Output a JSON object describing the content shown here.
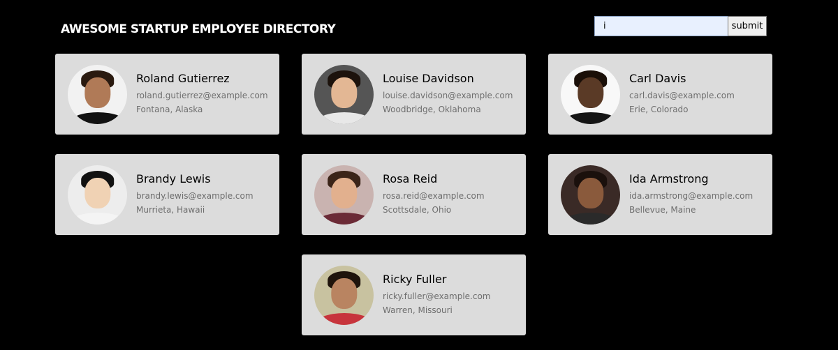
{
  "header": {
    "title": "AWESOME STARTUP EMPLOYEE DIRECTORY"
  },
  "search": {
    "value": "i",
    "submit_label": "submit"
  },
  "employees": [
    {
      "name": "Roland Gutierrez",
      "email": "roland.gutierrez@example.com",
      "location": "Fontana, Alaska",
      "bg": "#f2f2f2",
      "skin": "#b07a57",
      "hair": "#2a1a10",
      "shirt": "#111111"
    },
    {
      "name": "Louise Davidson",
      "email": "louise.davidson@example.com",
      "location": "Woodbridge, Oklahoma",
      "bg": "#555555",
      "skin": "#e3b794",
      "hair": "#1c120c",
      "shirt": "#e8e8e8"
    },
    {
      "name": "Carl Davis",
      "email": "carl.davis@example.com",
      "location": "Erie, Colorado",
      "bg": "#f8f8f8",
      "skin": "#5a3a26",
      "hair": "#1a0f08",
      "shirt": "#151515"
    },
    {
      "name": "Brandy Lewis",
      "email": "brandy.lewis@example.com",
      "location": "Murrieta, Hawaii",
      "bg": "#ededed",
      "skin": "#f0d2b4",
      "hair": "#111111",
      "shirt": "#f4f4f4"
    },
    {
      "name": "Rosa Reid",
      "email": "rosa.reid@example.com",
      "location": "Scottsdale, Ohio",
      "bg": "#c9b3b0",
      "skin": "#e2b08e",
      "hair": "#3b2418",
      "shirt": "#6b2a36"
    },
    {
      "name": "Ida Armstrong",
      "email": "ida.armstrong@example.com",
      "location": "Bellevue, Maine",
      "bg": "#3a2a26",
      "skin": "#8a5a3c",
      "hair": "#1a100c",
      "shirt": "#2a2a2a"
    },
    {
      "name": "Ricky Fuller",
      "email": "ricky.fuller@example.com",
      "location": "Warren, Missouri",
      "bg": "#c8c2a0",
      "skin": "#b98461",
      "hair": "#1f140c",
      "shirt": "#c7343c"
    }
  ]
}
